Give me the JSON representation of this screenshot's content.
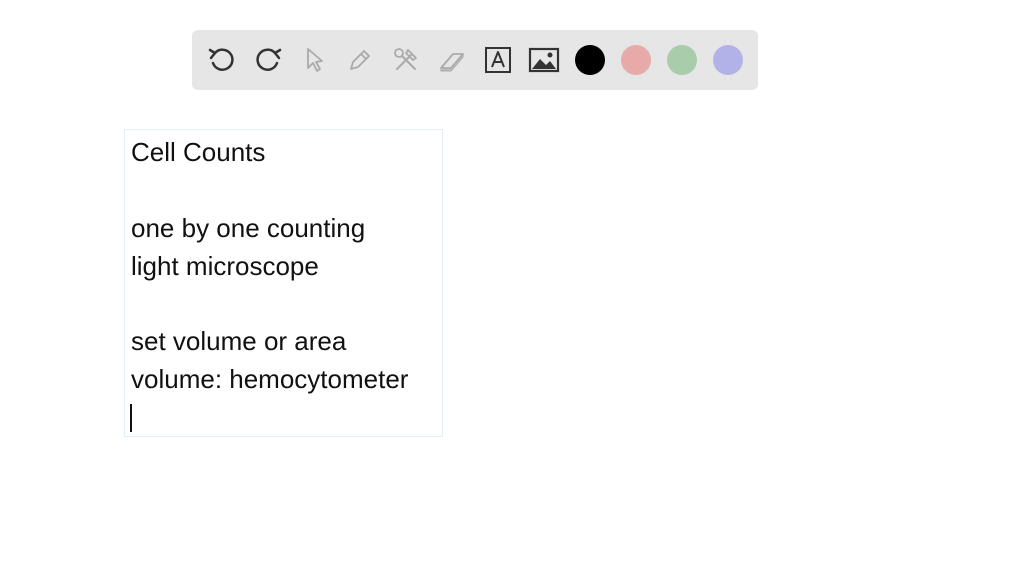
{
  "toolbar": {
    "tools": [
      {
        "name": "undo-icon",
        "icon": "undo"
      },
      {
        "name": "redo-icon",
        "icon": "redo"
      },
      {
        "name": "select-cursor-icon",
        "icon": "cursor"
      },
      {
        "name": "pen-icon",
        "icon": "pen"
      },
      {
        "name": "tools-icon",
        "icon": "hammer-wrench"
      },
      {
        "name": "eraser-icon",
        "icon": "eraser"
      },
      {
        "name": "text-tool-icon",
        "icon": "text-box"
      },
      {
        "name": "image-tool-icon",
        "icon": "image"
      }
    ],
    "colors": [
      "#000000",
      "#e8a9a9",
      "#a9ccaa",
      "#b2b2e8"
    ]
  },
  "note": {
    "title": "Cell Counts",
    "line1": "one by one counting",
    "line2": "light microscope",
    "line3": "set volume or area",
    "line4": "volume: hemocytometer"
  }
}
